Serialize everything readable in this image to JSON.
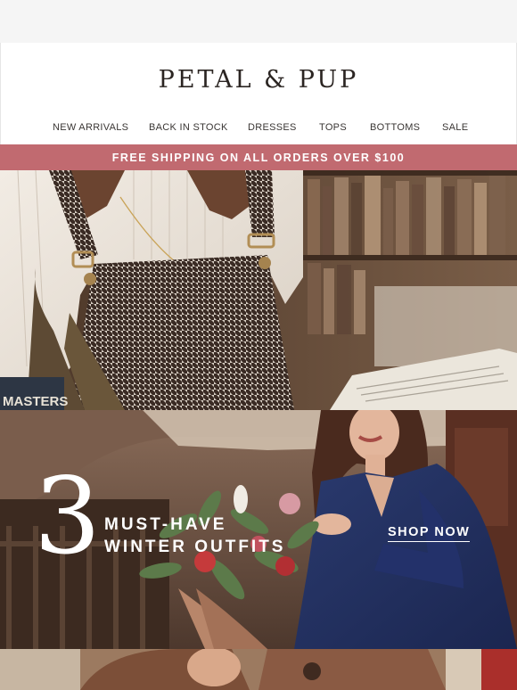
{
  "brand": {
    "logo_text": "PETAL & PUP"
  },
  "nav": {
    "items": [
      {
        "label": "NEW ARRIVALS"
      },
      {
        "label": "BACK IN STOCK"
      },
      {
        "label": "DRESSES"
      },
      {
        "label": "TOPS"
      },
      {
        "label": "BOTTOMS"
      },
      {
        "label": "SALE"
      }
    ]
  },
  "promo_banner": {
    "text": "FREE SHIPPING ON ALL ORDERS OVER $100",
    "background_color": "#c16a70"
  },
  "feature": {
    "number": "3",
    "headline_line1": "MUST-HAVE",
    "headline_line2": "WINTER OUTFITS",
    "cta_label": "SHOP NOW"
  }
}
